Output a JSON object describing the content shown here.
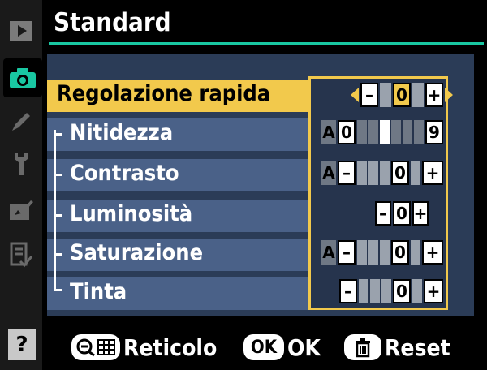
{
  "sidebar": {
    "tabs": [
      {
        "name": "playback-tab",
        "icon": "playback-icon",
        "active": false
      },
      {
        "name": "shooting-tab",
        "icon": "camera-icon",
        "active": true
      },
      {
        "name": "custom-settings-tab",
        "icon": "pencil-icon",
        "active": false
      },
      {
        "name": "setup-tab",
        "icon": "wrench-icon",
        "active": false
      },
      {
        "name": "retouch-tab",
        "icon": "brush-icon",
        "active": false
      },
      {
        "name": "recent-settings-tab",
        "icon": "list-check-icon",
        "active": false
      }
    ],
    "help_label": "?"
  },
  "header": {
    "title": "Standard",
    "accent_color": "#19c7a2"
  },
  "menu": {
    "items": [
      {
        "label": "Regolazione rapida",
        "selected": true
      },
      {
        "label": "Nitidezza",
        "selected": false
      },
      {
        "label": "Contrasto",
        "selected": false
      },
      {
        "label": "Luminosità",
        "selected": false
      },
      {
        "label": "Saturazione",
        "selected": false
      },
      {
        "label": "Tinta",
        "selected": false
      }
    ],
    "highlight_color": "#f2c94c"
  },
  "values": {
    "quick_adjust": {
      "value": "0",
      "minus": "–",
      "plus": "+"
    },
    "sharpening": {
      "auto": "A",
      "min_label": "0",
      "max_label": "9",
      "level": 3
    },
    "contrast": {
      "auto": "A",
      "value": "0",
      "minus": "–",
      "plus": "+"
    },
    "brightness": {
      "value": "0",
      "minus": "–",
      "plus": "+"
    },
    "saturation": {
      "auto": "A",
      "value": "0",
      "minus": "–",
      "plus": "+"
    },
    "hue": {
      "value": "0",
      "minus": "–",
      "plus": "+"
    }
  },
  "footer": {
    "grid_label": "Reticolo",
    "ok_icon_label": "OK",
    "ok_label": "OK",
    "reset_label": "Reset"
  }
}
